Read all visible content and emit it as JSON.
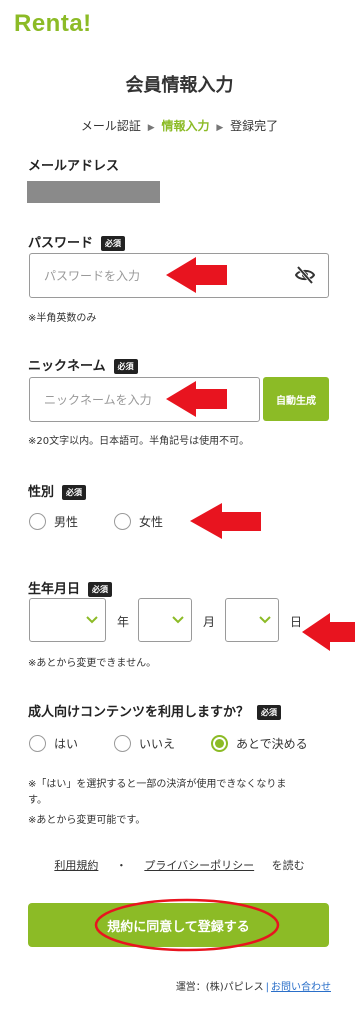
{
  "logo": "Renta!",
  "title": "会員情報入力",
  "steps": [
    "メール認証",
    "情報入力",
    "登録完了"
  ],
  "email": {
    "label": "メールアドレス"
  },
  "password": {
    "label": "パスワード",
    "badge": "必須",
    "placeholder": "パスワードを入力",
    "note": "※半角英数のみ"
  },
  "nickname": {
    "label": "ニックネーム",
    "badge": "必須",
    "placeholder": "ニックネームを入力",
    "auto_button": "自動生成",
    "note": "※20文字以内。日本語可。半角記号は使用不可。"
  },
  "gender": {
    "label": "性別",
    "badge": "必須",
    "options": [
      "男性",
      "女性"
    ]
  },
  "birthdate": {
    "label": "生年月日",
    "badge": "必須",
    "units": [
      "年",
      "月",
      "日"
    ],
    "note": "※あとから変更できません。"
  },
  "adult": {
    "label": "成人向けコンテンツを利用しますか？",
    "badge": "必須",
    "options": [
      "はい",
      "いいえ",
      "あとで決める"
    ],
    "selected": "あとで決める",
    "note1": "※「はい」を選択すると一部の決済が使用できなくなりま",
    "note1b": "す。",
    "note2": "※あとから変更可能です。"
  },
  "terms": {
    "terms_link": "利用規約",
    "dot": "・",
    "privacy_link": "プライバシーポリシー",
    "suffix": "を読む"
  },
  "submit": "規約に同意して登録する",
  "footer": {
    "operator": "運営：(株)パピレス",
    "divider": "|",
    "contact": "お問い合わせ"
  },
  "colors": {
    "accent": "#8cbb26",
    "annotation": "#e8141f",
    "link": "#2a6fc9"
  }
}
